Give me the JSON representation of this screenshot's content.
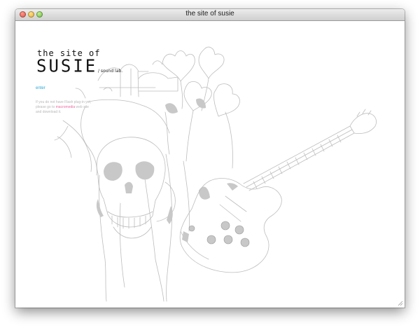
{
  "window": {
    "title": "the site of susie"
  },
  "logo": {
    "line1": "the site of",
    "line2": "SUSIE",
    "tag": "/ sound lab."
  },
  "nav": {
    "enter": "enter"
  },
  "notice": {
    "pre": "If you do not have Flash plug-in yet, please go to ",
    "link": "macromedia",
    "post": " web site and download it."
  },
  "colors": {
    "accent_link": "#29a8d8",
    "highlight_link": "#f06aa0",
    "line_art": "#bdbdbd",
    "art_fill": "#c8c8c8"
  },
  "icons": [
    "close-icon",
    "minimize-icon",
    "zoom-icon",
    "resize-grip-icon"
  ]
}
